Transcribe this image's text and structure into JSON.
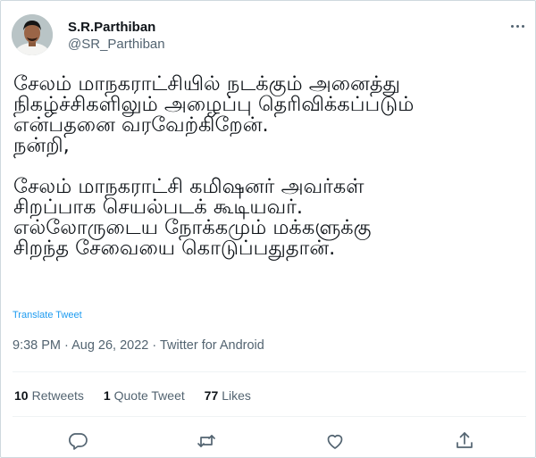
{
  "author": {
    "name": "S.R.Parthiban",
    "handle": "@SR_Parthiban"
  },
  "tweet": {
    "text": "சேலம் மாநகராட்சியில் நடக்கும் அனைத்து\nநிகழ்ச்சிகளிலும் அழைப்பு தெரிவிக்கப்படும்\nஎன்பதனை வரவேற்கிறேன்.\nநன்றி,\n\nசேலம் மாநகராட்சி கமிஷனர் அவர்கள்\nசிறப்பாக செயல்படக் கூடியவர்.\nஎல்லோருடைய நோக்கமும் மக்களுக்கு\nசிறந்த சேவையை கொடுப்பதுதான்.",
    "translate_label": "Translate Tweet",
    "timestamp": "9:38 PM · Aug 26, 2022 · Twitter for Android"
  },
  "stats": {
    "retweets_count": "10",
    "retweets_label": "Retweets",
    "quotes_count": "1",
    "quotes_label": "Quote Tweet",
    "likes_count": "77",
    "likes_label": "Likes"
  },
  "icons": {
    "more": "more-horizontal-icon",
    "reply": "reply-icon",
    "retweet": "retweet-icon",
    "like": "heart-icon",
    "share": "share-icon"
  },
  "colors": {
    "link": "#1d9bf0",
    "secondary_text": "#536471",
    "primary_text": "#0f1419",
    "divider": "#eff3f4"
  }
}
